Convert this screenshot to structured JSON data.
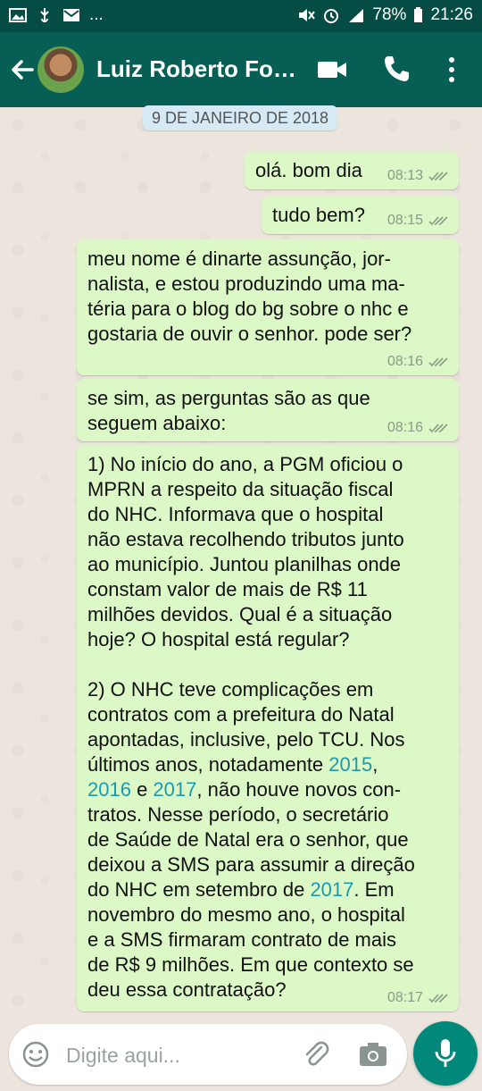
{
  "status_bar": {
    "battery": "78%",
    "time": "21:26",
    "ellipsis": "..."
  },
  "header": {
    "contact_name": "Luiz Roberto Fon..."
  },
  "chat": {
    "date_separator": "9 DE JANEIRO DE 2018",
    "messages": [
      {
        "text": "olá. bom dia",
        "time": "08:13"
      },
      {
        "text": "tudo bem?",
        "time": "08:15"
      },
      {
        "text": "meu nome é dinarte assunção, jor-\nnalista, e estou produzindo uma ma-\ntéria para o blog do bg sobre o nhc e\ngostaria de ouvir o senhor. pode ser?",
        "time": "08:16"
      },
      {
        "text": "se sim, as perguntas são as que\nseguem abaixo:",
        "time": "08:16"
      },
      {
        "time": "08:17",
        "p1": "1) No início do ano, a PGM oficiou o\nMPRN a respeito da situação fiscal\ndo NHC. Informava que o hospital\nnão estava recolhendo tributos junto\nao município. Juntou planilhas onde\nconstam valor de mais de R$ 11\nmilhões devidos. Qual é a situação\nhoje? O hospital está regular?",
        "p2a": "2) O NHC teve complicações em\ncontratos com a prefeitura do Natal\napontadas, inclusive, pelo TCU. Nos\núltimos anos, notadamente ",
        "y1": "2015",
        "comma": ",\n",
        "y2": "2016",
        "and": " e ",
        "y3": "2017",
        "p2b": ", não houve novos con-\ntratos. Nesse período, o secretário\nde Saúde de Natal era o senhor, que\ndeixou a SMS para assumir a direção\ndo NHC em setembro de ",
        "y4": "2017",
        "p2c": ". Em\nnovembro do mesmo ano, o hospital\ne a SMS firmaram contrato de mais\nde R$ 9 milhões. Em que contexto se\ndeu essa contratação?"
      }
    ]
  },
  "input": {
    "placeholder": "Digite aqui..."
  },
  "colors": {
    "header": "#075e54",
    "status_bar": "#054d44",
    "outgoing_bubble": "#dcf8c6",
    "link": "#1a9bb0",
    "mic_button": "#00897b"
  }
}
